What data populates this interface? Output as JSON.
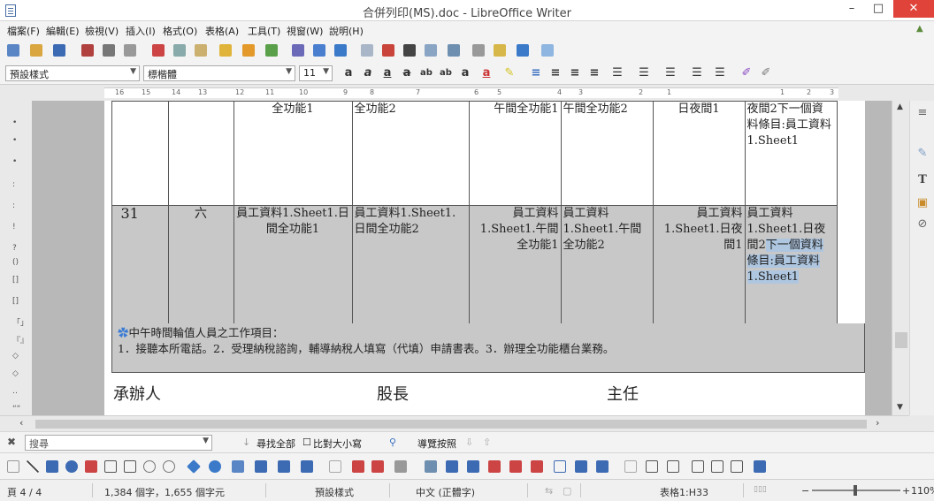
{
  "window": {
    "title": "合併列印(MS).doc - LibreOffice Writer",
    "min_glyph": "–",
    "max_glyph": "□",
    "close_glyph": "✕"
  },
  "menus": [
    "檔案(F)",
    "編輯(E)",
    "檢視(V)",
    "插入(I)",
    "格式(O)",
    "表格(A)",
    "工具(T)",
    "視窗(W)",
    "說明(H)"
  ],
  "format_bar": {
    "paragraph_style": "預設樣式",
    "font_name": "標楷體",
    "font_size": "11"
  },
  "ruler_numbers": [
    "16",
    "15",
    "14",
    "13",
    "12",
    "11",
    "10",
    "9",
    "8",
    "7",
    "6",
    "5",
    "4",
    "3",
    "2",
    "1",
    "1",
    "2",
    "3"
  ],
  "table": {
    "row1": {
      "c1": "",
      "c2": "",
      "c3": "全功能1",
      "c4": "全功能2",
      "c5": "午間全功能1",
      "c6": "午間全功能2",
      "c7": "日夜間1",
      "c8": "夜間2下一個資料條目:員工資料1.Sheet1"
    },
    "row2": {
      "c1": "31",
      "c2": "六",
      "c3": "員工資料1.Sheet1.日間全功能1",
      "c4": "員工資料1.Sheet1.日間全功能2",
      "c5": "員工資料1.Sheet1.午間全功能1",
      "c6": "員工資料1.Sheet1.午間全功能2",
      "c7": "員工資料1.Sheet1.日夜間1",
      "c8_prefix": "員工資料1.Sheet1.日夜間2",
      "c8_selected": "下一個資料條目:員工資料1.Sheet1"
    }
  },
  "note": {
    "heading": "中午時間輪值人員之工作項目：",
    "body": "1．接聽本所電話。2．受理納稅諮詢，輔導納稅人填寫（代填）申請書表。3．辦理全功能櫃台業務。"
  },
  "signatures": [
    "承辦人",
    "股長",
    "主任"
  ],
  "findbar": {
    "placeholder": "搜尋",
    "find_all": "尋找全部",
    "match_case": "比對大小寫",
    "navigate": "導覽按照"
  },
  "status": {
    "page": "頁 4 / 4",
    "words": "1,384 個字，1,655 個字元",
    "style": "預設樣式",
    "language": "中文 (正體字)",
    "table_cell": "表格1:H33",
    "zoom": "110%"
  }
}
